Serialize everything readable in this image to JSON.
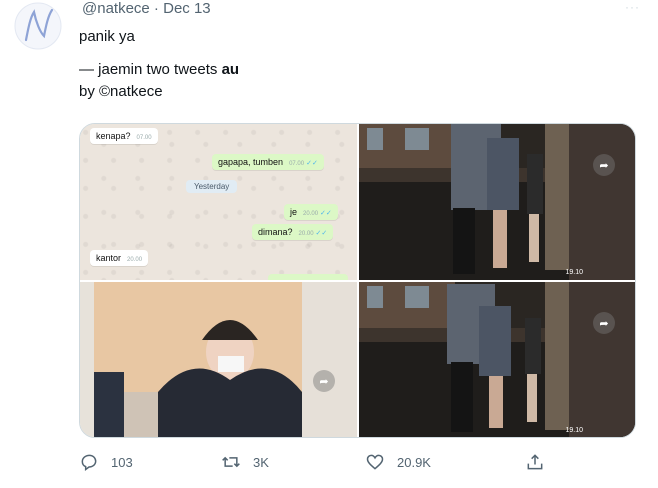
{
  "tweet": {
    "handle": "@natkece",
    "separator": " · ",
    "date": "Dec 13",
    "lines": [
      "panik ya",
      "— jaemin two tweets ",
      "by ©natkece"
    ],
    "bold_word": "au"
  },
  "chat": {
    "m1": "kenapa?",
    "m1_time": "07.00",
    "m2": "gapapa, tumben",
    "m2_time": "07.00",
    "day": "Yesterday",
    "m3": "je",
    "m3_time": "20.00",
    "m4": "dimana?",
    "m4_time": "20.00",
    "m5": "kantor",
    "m5_time": "20.00"
  },
  "photo_stamps": {
    "top_right": "19.10",
    "bottom_right": "19.10"
  },
  "actions": {
    "replies": "103",
    "retweets": "3K",
    "likes": "20.9K"
  },
  "colors": {
    "text": "#0f1419",
    "muted": "#536471",
    "border": "#cfd9de"
  }
}
